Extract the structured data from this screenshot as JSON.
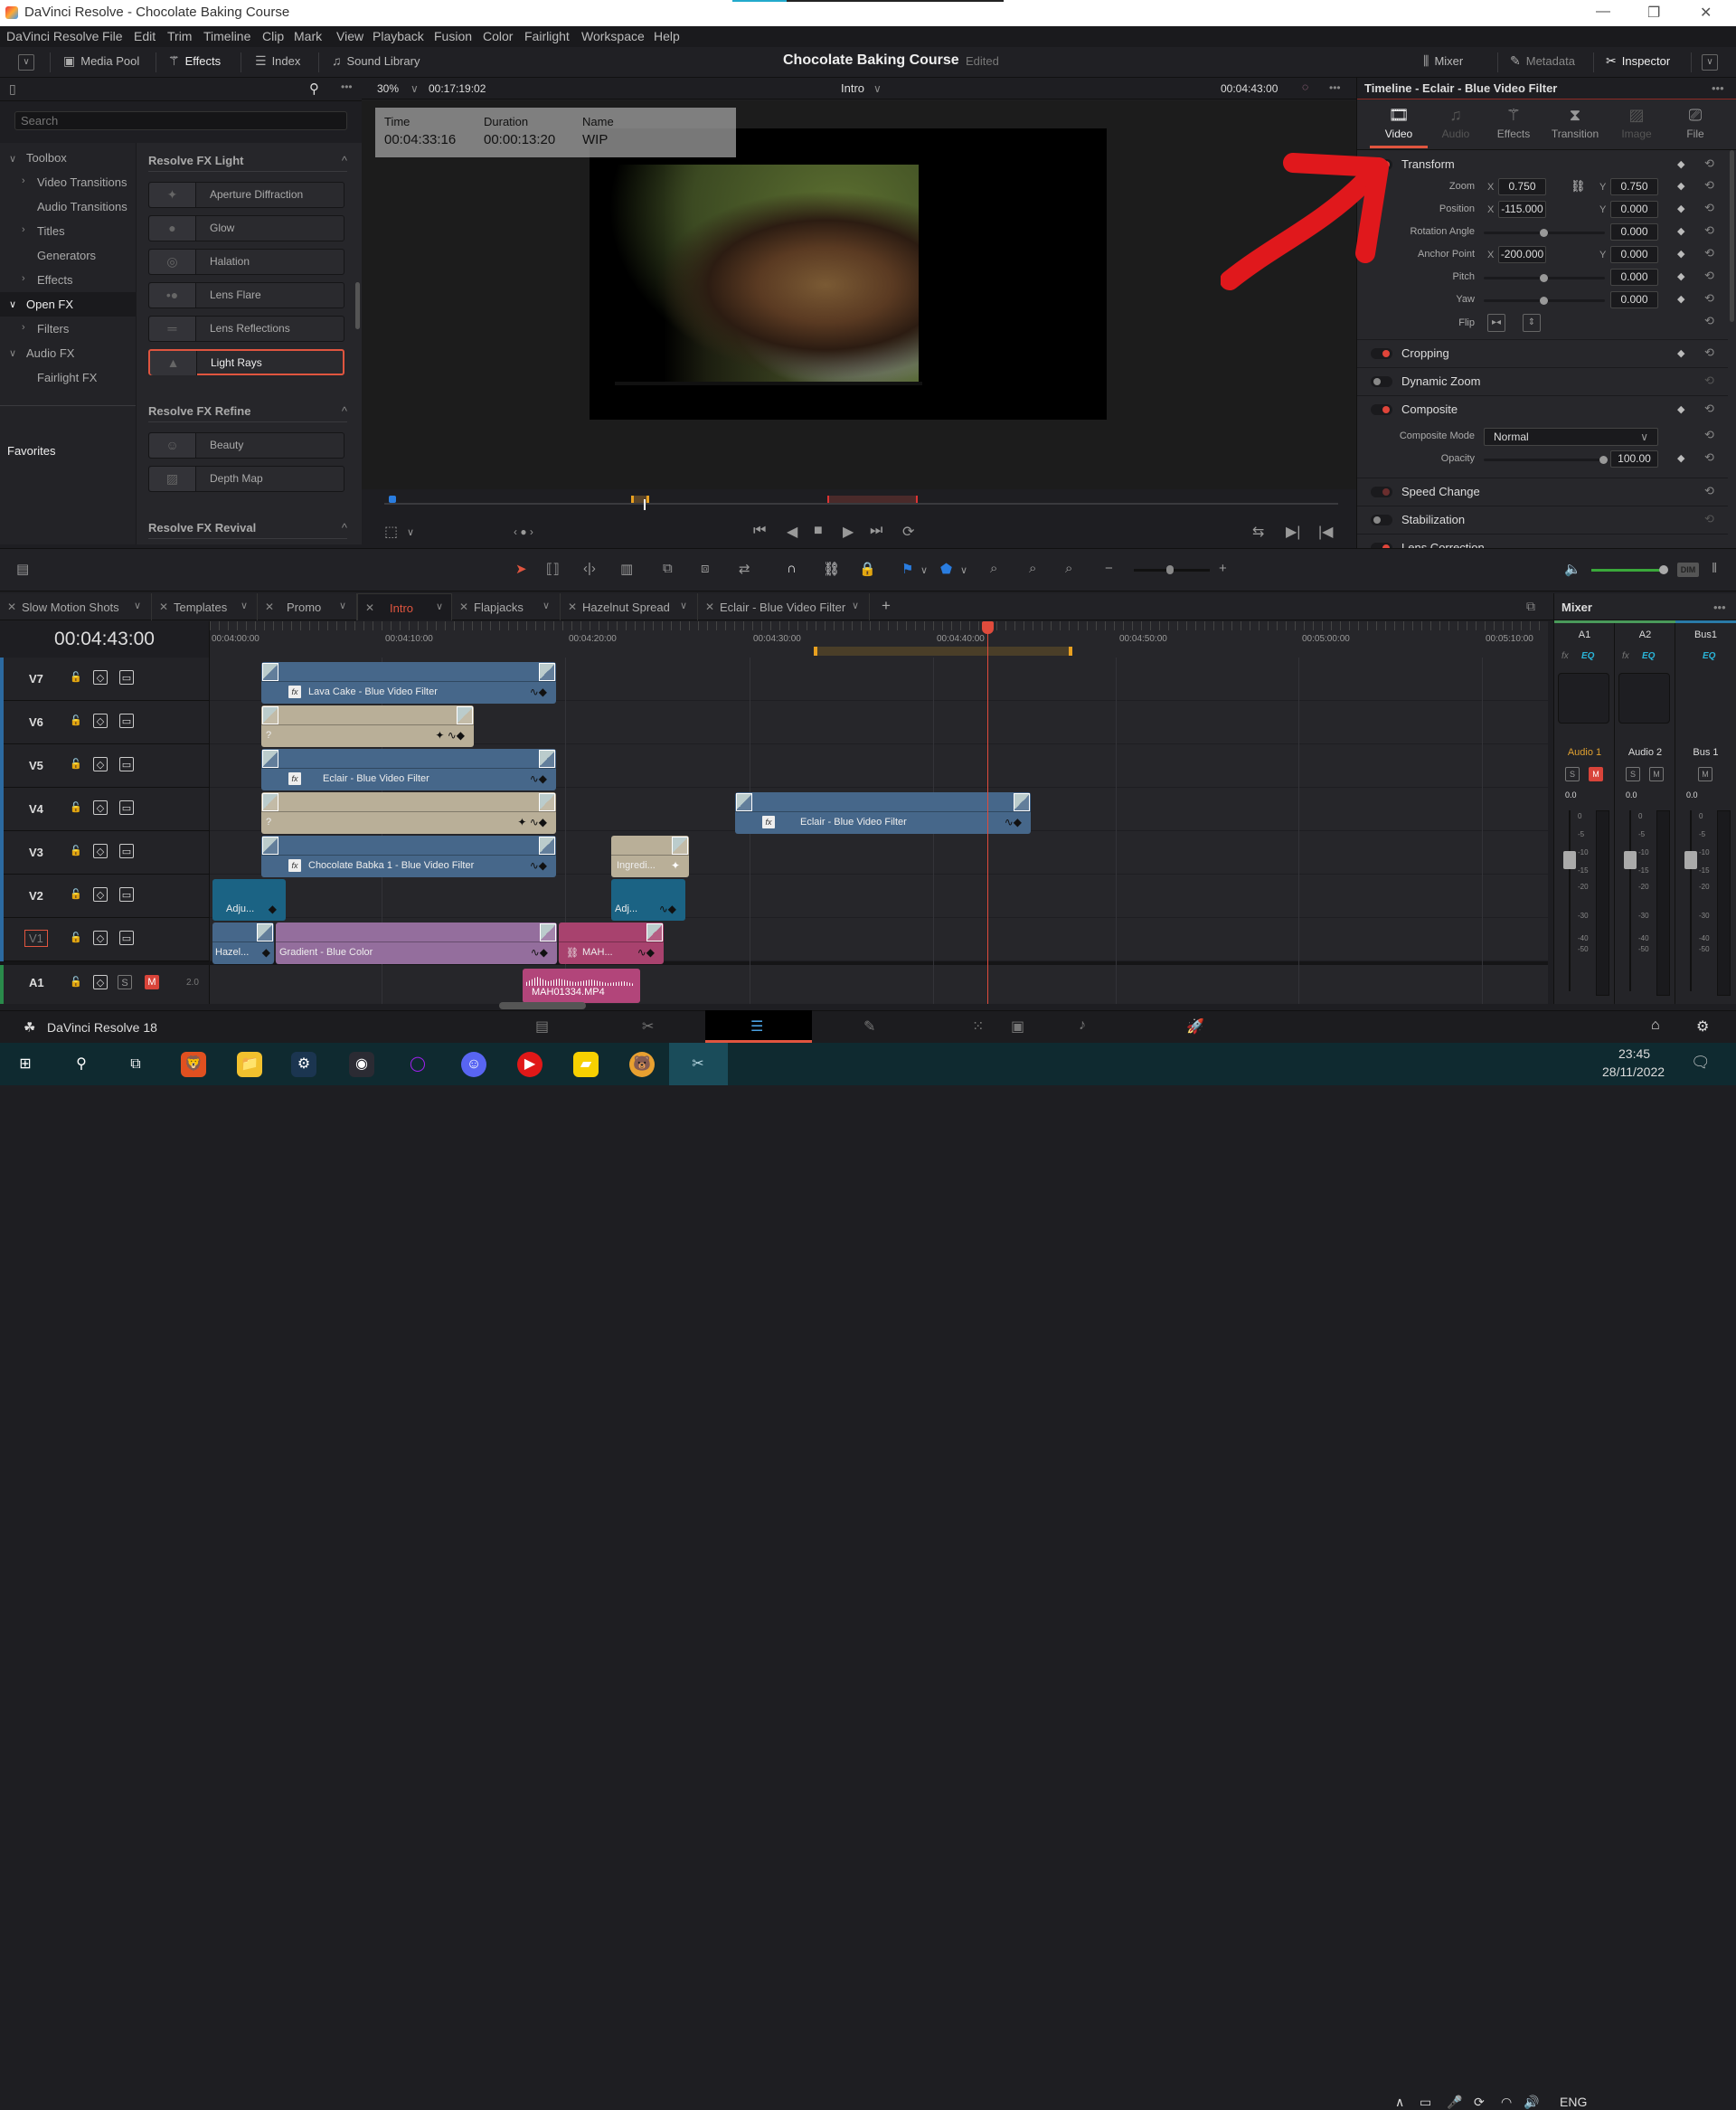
{
  "window": {
    "title": "DaVinci Resolve - Chocolate Baking Course"
  },
  "menu": [
    "DaVinci Resolve",
    "File",
    "Edit",
    "Trim",
    "Timeline",
    "Clip",
    "Mark",
    "View",
    "Playback",
    "Fusion",
    "Color",
    "Fairlight",
    "Workspace",
    "Help"
  ],
  "toolbar": {
    "left": [
      {
        "label": "Media Pool",
        "icon": "media-pool-icon"
      },
      {
        "label": "Effects",
        "icon": "effects-wand-icon"
      },
      {
        "label": "Index",
        "icon": "index-list-icon"
      },
      {
        "label": "Sound Library",
        "icon": "sound-library-icon"
      }
    ],
    "project_title": "Chocolate Baking Course",
    "project_status": "Edited",
    "right": [
      {
        "label": "Mixer",
        "icon": "mixer-icon"
      },
      {
        "label": "Metadata",
        "icon": "metadata-icon"
      },
      {
        "label": "Inspector",
        "icon": "inspector-icon"
      }
    ]
  },
  "effects_panel": {
    "search_placeholder": "Search",
    "tree": [
      {
        "label": "Toolbox",
        "level": 0,
        "chevron": "down"
      },
      {
        "label": "Video Transitions",
        "level": 1,
        "chevron": "right"
      },
      {
        "label": "Audio Transitions",
        "level": 1,
        "chevron": ""
      },
      {
        "label": "Titles",
        "level": 1,
        "chevron": "right"
      },
      {
        "label": "Generators",
        "level": 1,
        "chevron": ""
      },
      {
        "label": "Effects",
        "level": 1,
        "chevron": "right"
      },
      {
        "label": "Open FX",
        "level": 0,
        "chevron": "down",
        "selected": true
      },
      {
        "label": "Filters",
        "level": 1,
        "chevron": "right"
      },
      {
        "label": "Audio FX",
        "level": 0,
        "chevron": "down"
      },
      {
        "label": "Fairlight FX",
        "level": 1,
        "chevron": ""
      }
    ],
    "favorites_label": "Favorites",
    "sections": [
      {
        "title": "Resolve FX Light",
        "items": [
          "Aperture Diffraction",
          "Glow",
          "Halation",
          "Lens Flare",
          "Lens Reflections",
          "Light Rays"
        ],
        "selected": "Light Rays"
      },
      {
        "title": "Resolve FX Refine",
        "items": [
          "Beauty",
          "Depth Map"
        ]
      },
      {
        "title": "Resolve FX Revival",
        "items": []
      }
    ]
  },
  "viewer": {
    "zoom": "30%",
    "duration_tc": "00:17:19:02",
    "timeline_name": "Intro",
    "current_tc": "00:04:43:00",
    "info": {
      "time_label": "Time",
      "time": "00:04:33:16",
      "duration_label": "Duration",
      "duration": "00:00:13:20",
      "name_label": "Name",
      "name": "WIP"
    }
  },
  "inspector": {
    "title": "Timeline - Eclair - Blue Video Filter",
    "tabs": [
      {
        "label": "Video",
        "state": "active"
      },
      {
        "label": "Audio",
        "state": "disabled"
      },
      {
        "label": "Effects",
        "state": "normal"
      },
      {
        "label": "Transition",
        "state": "normal"
      },
      {
        "label": "Image",
        "state": "disabled"
      },
      {
        "label": "File",
        "state": "normal"
      }
    ],
    "transform": {
      "title": "Transform",
      "zoom": {
        "label": "Zoom",
        "x": "0.750",
        "y": "0.750"
      },
      "position": {
        "label": "Position",
        "x": "-115.000",
        "y": "0.000"
      },
      "rotation": {
        "label": "Rotation Angle",
        "value": "0.000"
      },
      "anchor": {
        "label": "Anchor Point",
        "x": "-200.000",
        "y": "0.000"
      },
      "pitch": {
        "label": "Pitch",
        "value": "0.000"
      },
      "yaw": {
        "label": "Yaw",
        "value": "0.000"
      },
      "flip": {
        "label": "Flip"
      }
    },
    "sections": [
      {
        "title": "Cropping",
        "enabled": true
      },
      {
        "title": "Dynamic Zoom",
        "enabled": false
      },
      {
        "title": "Composite",
        "enabled": true
      },
      {
        "title": "Speed Change",
        "enabled": "dim"
      },
      {
        "title": "Stabilization",
        "enabled": false
      },
      {
        "title": "Lens Correction",
        "enabled": true
      }
    ],
    "composite": {
      "mode_label": "Composite Mode",
      "mode": "Normal",
      "opacity_label": "Opacity",
      "opacity": "100.00"
    },
    "axis_x": "X",
    "axis_y": "Y"
  },
  "timeline_tabs": [
    {
      "label": "Slow Motion Shots"
    },
    {
      "label": "Templates"
    },
    {
      "label": "Promo"
    },
    {
      "label": "Intro",
      "active": true
    },
    {
      "label": "Flapjacks"
    },
    {
      "label": "Hazelnut Spread"
    },
    {
      "label": "Eclair - Blue Video Filter"
    }
  ],
  "timeline": {
    "timecode": "00:04:43:00",
    "ruler": [
      "00:04:00:00",
      "00:04:10:00",
      "00:04:20:00",
      "00:04:30:00",
      "00:04:40:00",
      "00:04:50:00",
      "00:05:00:00",
      "00:05:10:00"
    ],
    "tracks": [
      {
        "name": "V7",
        "clips": [
          {
            "label": "Lava Cake - Blue Video Filter",
            "color": "blue"
          }
        ]
      },
      {
        "name": "V6",
        "clips": [
          {
            "label": "?",
            "color": "tan"
          }
        ]
      },
      {
        "name": "V5",
        "clips": [
          {
            "label": "Eclair - Blue Video Filter",
            "color": "blue"
          }
        ]
      },
      {
        "name": "V4",
        "clips": [
          {
            "label": "?",
            "color": "tan"
          },
          {
            "label": "Eclair - Blue Video Filter",
            "color": "blue"
          }
        ]
      },
      {
        "name": "V3",
        "clips": [
          {
            "label": "Chocolate Babka 1 - Blue Video Filter",
            "color": "blue"
          },
          {
            "label": "Ingredi...",
            "color": "tan"
          }
        ]
      },
      {
        "name": "V2",
        "clips": [
          {
            "label": "Adju...",
            "color": "teal"
          },
          {
            "label": "Adj...",
            "color": "teal"
          }
        ]
      },
      {
        "name": "V1",
        "clips": [
          {
            "label": "Hazel...",
            "color": "blue"
          },
          {
            "label": "Gradient - Blue Color",
            "color": "purple"
          },
          {
            "label": "MAH...",
            "color": "pink"
          }
        ]
      },
      {
        "name": "A1",
        "clips": [
          {
            "label": "MAH01334.MP4",
            "color": "pink"
          }
        ],
        "audio_channels": "2.0",
        "solo": "S",
        "mute": "M"
      }
    ]
  },
  "mixer": {
    "title": "Mixer",
    "channels": [
      {
        "id": "A1",
        "name": "Audio 1",
        "level": "0.0",
        "solo": true,
        "muted": true
      },
      {
        "id": "A2",
        "name": "Audio 2",
        "level": "0.0",
        "solo": true,
        "muted": false
      },
      {
        "id": "Bus1",
        "name": "Bus 1",
        "level": "0.0",
        "solo": false,
        "muted": false
      }
    ],
    "fx": "fx",
    "eq": "EQ",
    "scale": [
      "0",
      "-5",
      "-10",
      "-15",
      "-20",
      "-30",
      "-40",
      "-50"
    ],
    "dim_label": "DIM"
  },
  "pagebar": {
    "brand": "DaVinci Resolve 18",
    "pages": [
      "media",
      "cut",
      "edit",
      "fusion",
      "color",
      "fairlight",
      "deliver"
    ],
    "active": "edit"
  },
  "taskbar": {
    "lang": "ENG",
    "time": "23:45",
    "date": "28/11/2022"
  }
}
